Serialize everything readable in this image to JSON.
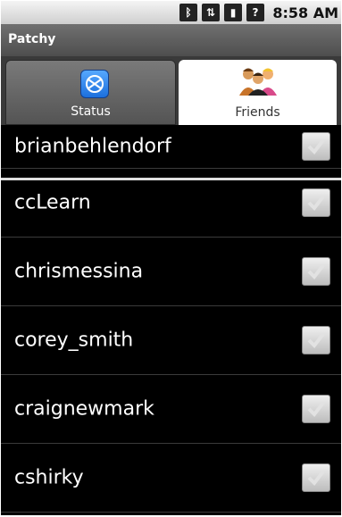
{
  "status_bar": {
    "icons": [
      "bluetooth-icon",
      "data-transfer-icon",
      "signal-icon",
      "alert-icon"
    ],
    "time": "8:58 AM"
  },
  "app": {
    "title": "Patchy"
  },
  "tabs": [
    {
      "label": "Status",
      "icon": "status-globe-icon",
      "selected": false
    },
    {
      "label": "Friends",
      "icon": "friends-people-icon",
      "selected": true
    }
  ],
  "friends": [
    {
      "name": "brianbehlendorf",
      "checked": false
    },
    {
      "name": "ccLearn",
      "checked": false
    },
    {
      "name": "chrismessina",
      "checked": false
    },
    {
      "name": "corey_smith",
      "checked": false
    },
    {
      "name": "craignewmark",
      "checked": false
    },
    {
      "name": "cshirky",
      "checked": false
    }
  ],
  "colors": {
    "background": "#000000",
    "text": "#ffffff",
    "title_bar": "#5a5a5a"
  }
}
